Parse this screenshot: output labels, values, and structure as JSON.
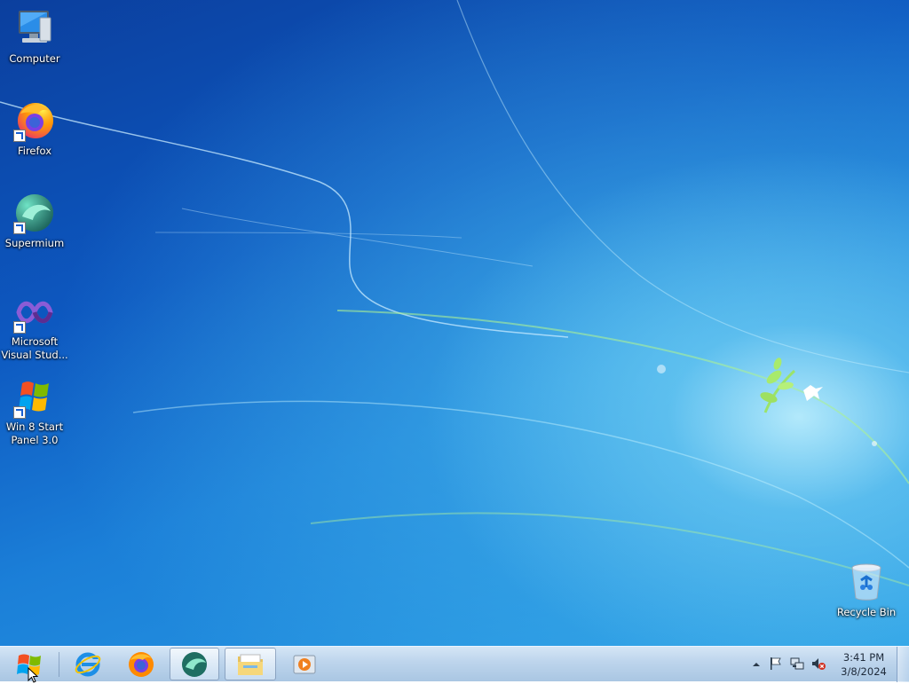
{
  "desktop": {
    "icons": [
      {
        "label": "Computer",
        "icon": "computer-icon"
      },
      {
        "label": "Firefox",
        "icon": "firefox-icon"
      },
      {
        "label": "Supermium",
        "icon": "supermium-icon"
      },
      {
        "label_line1": "Microsoft",
        "label_line2": "Visual Stud...",
        "icon": "visual-studio-icon"
      },
      {
        "label_line1": "Win 8 Start",
        "label_line2": "Panel 3.0",
        "icon": "windows-logo-icon"
      },
      {
        "label": "Recycle Bin",
        "icon": "recycle-bin-icon"
      }
    ]
  },
  "taskbar": {
    "pinned": [
      {
        "icon": "internet-explorer-icon"
      },
      {
        "icon": "firefox-icon"
      },
      {
        "icon": "supermium-icon"
      },
      {
        "icon": "file-explorer-icon"
      },
      {
        "icon": "media-player-icon"
      }
    ],
    "tray": {
      "icons": [
        "show-hidden-icons-chevron",
        "action-center-flag-icon",
        "network-icon",
        "volume-muted-icon"
      ],
      "time": "3:41 PM",
      "date": "3/8/2024"
    }
  },
  "colors": {
    "wallpaper_dark": "#0b3f9e",
    "wallpaper_light": "#2aa0e6",
    "taskbar": "#b9d2eb"
  }
}
